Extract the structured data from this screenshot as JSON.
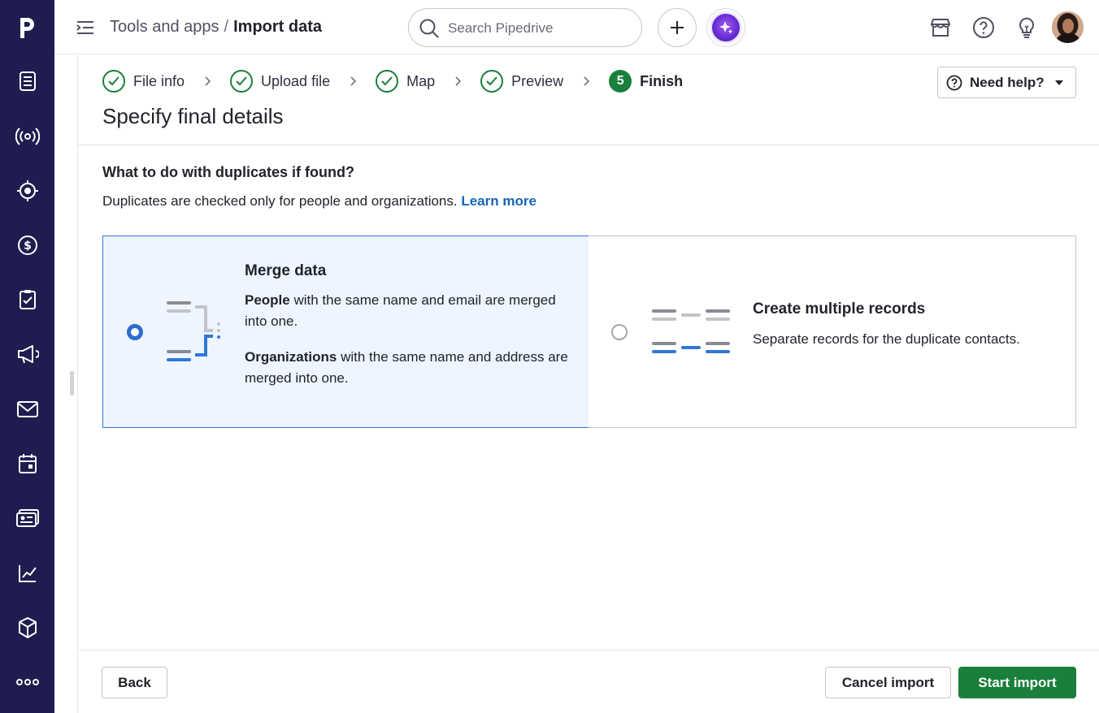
{
  "breadcrumb": {
    "parent": "Tools and apps",
    "separator": "/",
    "current": "Import data"
  },
  "search": {
    "placeholder": "Search Pipedrive"
  },
  "rail": {
    "brand": "p",
    "items": [
      "leads-icon",
      "campaigns-broadcast-icon",
      "target-icon",
      "deals-dollar-icon",
      "activities-clipboard-icon",
      "marketing-megaphone-icon",
      "mail-icon",
      "calendar-icon",
      "contacts-card-icon",
      "insights-chart-icon",
      "products-box-icon",
      "more-dots-icon"
    ]
  },
  "stepper": {
    "steps": [
      {
        "label": "File info",
        "status": "done"
      },
      {
        "label": "Upload file",
        "status": "done"
      },
      {
        "label": "Map",
        "status": "done"
      },
      {
        "label": "Preview",
        "status": "done"
      },
      {
        "label": "Finish",
        "status": "active",
        "number": "5"
      }
    ]
  },
  "help": {
    "label": "Need help?"
  },
  "page": {
    "title": "Specify final details"
  },
  "duplicates": {
    "question": "What to do with duplicates if found?",
    "description": "Duplicates are checked only for people and organizations.",
    "learn_more": "Learn more"
  },
  "options": {
    "merge": {
      "title": "Merge data",
      "people_bold": "People",
      "people_rest": " with the same name and email are merged into one.",
      "orgs_bold": "Organizations",
      "orgs_rest": " with the same name and address are merged into one.",
      "selected": true
    },
    "multiple": {
      "title": "Create multiple records",
      "text": "Separate records for the duplicate contacts.",
      "selected": false
    }
  },
  "footer": {
    "back": "Back",
    "cancel": "Cancel import",
    "start": "Start import"
  },
  "colors": {
    "rail": "#1f1c4f",
    "primary_green": "#1a7f3b",
    "link_blue": "#1664b8",
    "selected_bg": "#eef5ff",
    "selected_border": "#3178d8"
  }
}
